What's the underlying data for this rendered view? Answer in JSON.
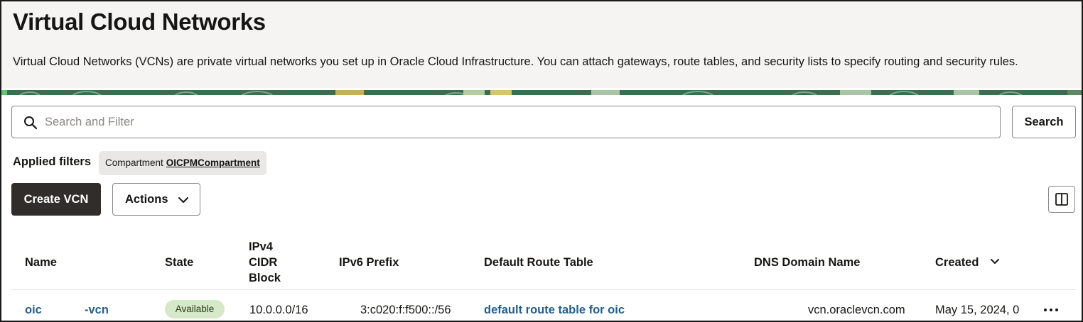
{
  "header": {
    "title": "Virtual Cloud Networks",
    "description": "Virtual Cloud Networks (VCNs) are private virtual networks you set up in Oracle Cloud Infrastructure. You can attach gateways, route tables, and security lists to specify routing and security rules."
  },
  "search": {
    "placeholder": "Search and Filter",
    "value": "",
    "button_label": "Search"
  },
  "filters": {
    "label": "Applied filters",
    "chips": [
      {
        "key": "Compartment",
        "value": "OICPMCompartment"
      }
    ]
  },
  "toolbar": {
    "create_label": "Create VCN",
    "actions_label": "Actions"
  },
  "table": {
    "columns": {
      "name": "Name",
      "state": "State",
      "ipv4_line1": "IPv4",
      "ipv4_line2": "CIDR",
      "ipv4_line3": "Block",
      "ipv6": "IPv6 Prefix",
      "route_table": "Default Route Table",
      "dns": "DNS Domain Name",
      "created": "Created"
    },
    "rows": [
      {
        "name_part1": "oic",
        "name_part2": "-vcn",
        "state": "Available",
        "ipv4": "10.0.0.0/16",
        "ipv6": "3:c020:f:f500::/56",
        "route_table": "default route table for oic",
        "dns": "vcn.oraclevcn.com",
        "created": "May 15, 2024, 0"
      }
    ]
  },
  "icons": {
    "search": "search-icon",
    "actions_chevron": "chevron-down-icon",
    "columns": "column-layout-icon",
    "sort": "sort-descending-icon",
    "row_menu": "more-horizontal-icon"
  },
  "colors": {
    "header_bg": "#f5f4f2",
    "primary_button": "#312d2a",
    "link": "#245f8a",
    "available_badge": "#d5e8c8",
    "band_green": "#3b6e4f"
  }
}
